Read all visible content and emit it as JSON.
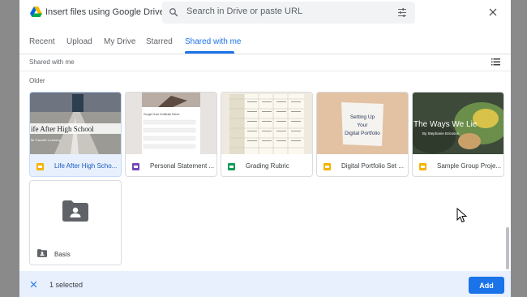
{
  "header": {
    "title": "Insert files using Google Drive",
    "search_placeholder": "Search in Drive or paste URL",
    "logo": "google-drive-logo",
    "icons": [
      "search-icon",
      "tune-icon",
      "close-icon"
    ]
  },
  "tabs": [
    {
      "label": "Recent",
      "active": false
    },
    {
      "label": "Upload",
      "active": false
    },
    {
      "label": "My Drive",
      "active": false
    },
    {
      "label": "Starred",
      "active": false
    },
    {
      "label": "Shared with me",
      "active": true
    }
  ],
  "breadcrumb": "Shared with me",
  "section_label": "Older",
  "files": [
    {
      "name": "Life After High Scho...",
      "type": "slides",
      "icon_color": "#f4b400",
      "selected": true,
      "thumb_text": "ife After High School",
      "thumb_subtext": "ife Transfer Learning"
    },
    {
      "name": "Personal Statement ...",
      "type": "forms",
      "icon_color": "#7248b9",
      "selected": false,
      "thumb_text": "Google Chart Certificate Rubric"
    },
    {
      "name": "Grading Rubric",
      "type": "sheets",
      "icon_color": "#0f9d58",
      "selected": false
    },
    {
      "name": "Digital Portfolio Set ...",
      "type": "slides",
      "icon_color": "#f4b400",
      "selected": false,
      "thumb_lines": [
        "Setting Up",
        "Your",
        "Digital Portfolio"
      ]
    },
    {
      "name": "Sample Group Proje...",
      "type": "slides",
      "icon_color": "#f4b400",
      "selected": false,
      "thumb_text": "The Ways We Lie",
      "thumb_subtext": "By Stephanie Ericsson"
    }
  ],
  "folder": {
    "name": "Basis",
    "icon": "shared-folder-icon"
  },
  "footer": {
    "selected_text": "1 selected",
    "add_label": "Add"
  },
  "colors": {
    "accent": "#1a73e8",
    "selected_bg": "#e8f0fe"
  }
}
